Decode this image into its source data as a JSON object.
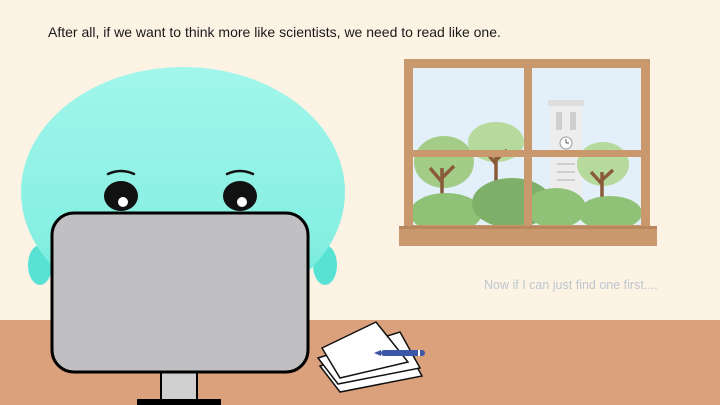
{
  "slide": {
    "caption": "After all, if we want to think more like scientists, we need to read like one.",
    "aside": "Now if I can just find one first....",
    "colors": {
      "background": "#fdf3e4",
      "desk": "#dba07c",
      "character": "#8ff2e6",
      "monitor": "#c0c0c2",
      "window_frame": "#c9986d",
      "sky": "#e3eff9",
      "foliage": "#8fc177",
      "aside_text": "#bcc6cf"
    }
  }
}
